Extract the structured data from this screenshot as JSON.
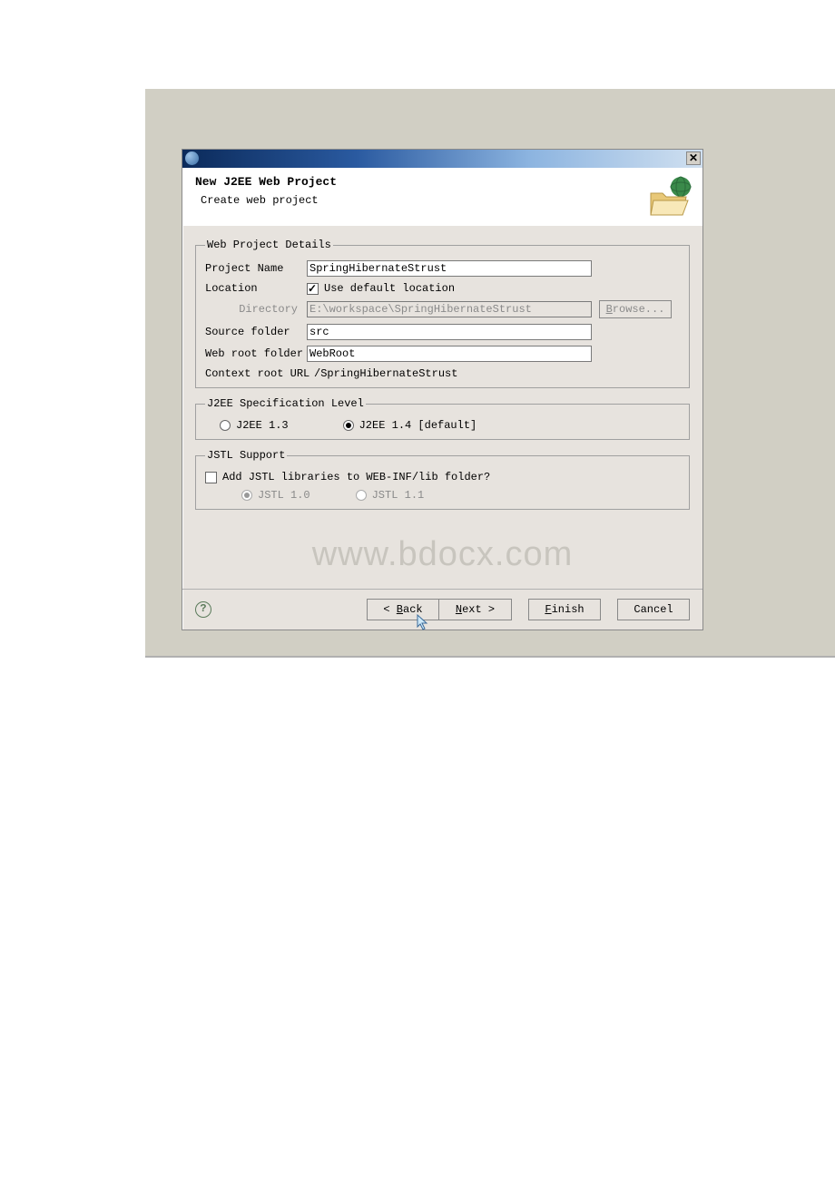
{
  "header": {
    "title": "New J2EE Web Project",
    "subtitle": "Create web project"
  },
  "details": {
    "legend": "Web Project Details",
    "projectNameLabel": "Project Name",
    "projectNameValue": "SpringHibernateStrust",
    "locationLabel": "Location",
    "useDefaultLabel": "Use default location",
    "directoryLabel": "Directory",
    "directoryValue": "E:\\workspace\\SpringHibernateStrust",
    "browseLabel": "Browse...",
    "sourceFolderLabel": "Source folder",
    "sourceFolderValue": "src",
    "webRootLabel": "Web root folder",
    "webRootValue": "WebRoot",
    "contextRootLabel": "Context root URL",
    "contextRootValue": "/SpringHibernateStrust"
  },
  "spec": {
    "legend": "J2EE Specification Level",
    "j2ee13": "J2EE 1.3",
    "j2ee14": "J2EE 1.4 [default]"
  },
  "jstl": {
    "legend": "JSTL Support",
    "addLabel": "Add JSTL libraries to WEB-INF/lib folder?",
    "jstl10": "JSTL 1.0",
    "jstl11": "JSTL 1.1"
  },
  "watermark": "www.bdocx.com",
  "buttons": {
    "back": "< Back",
    "next": "Next >",
    "finish": "Finish",
    "cancel": "Cancel"
  }
}
